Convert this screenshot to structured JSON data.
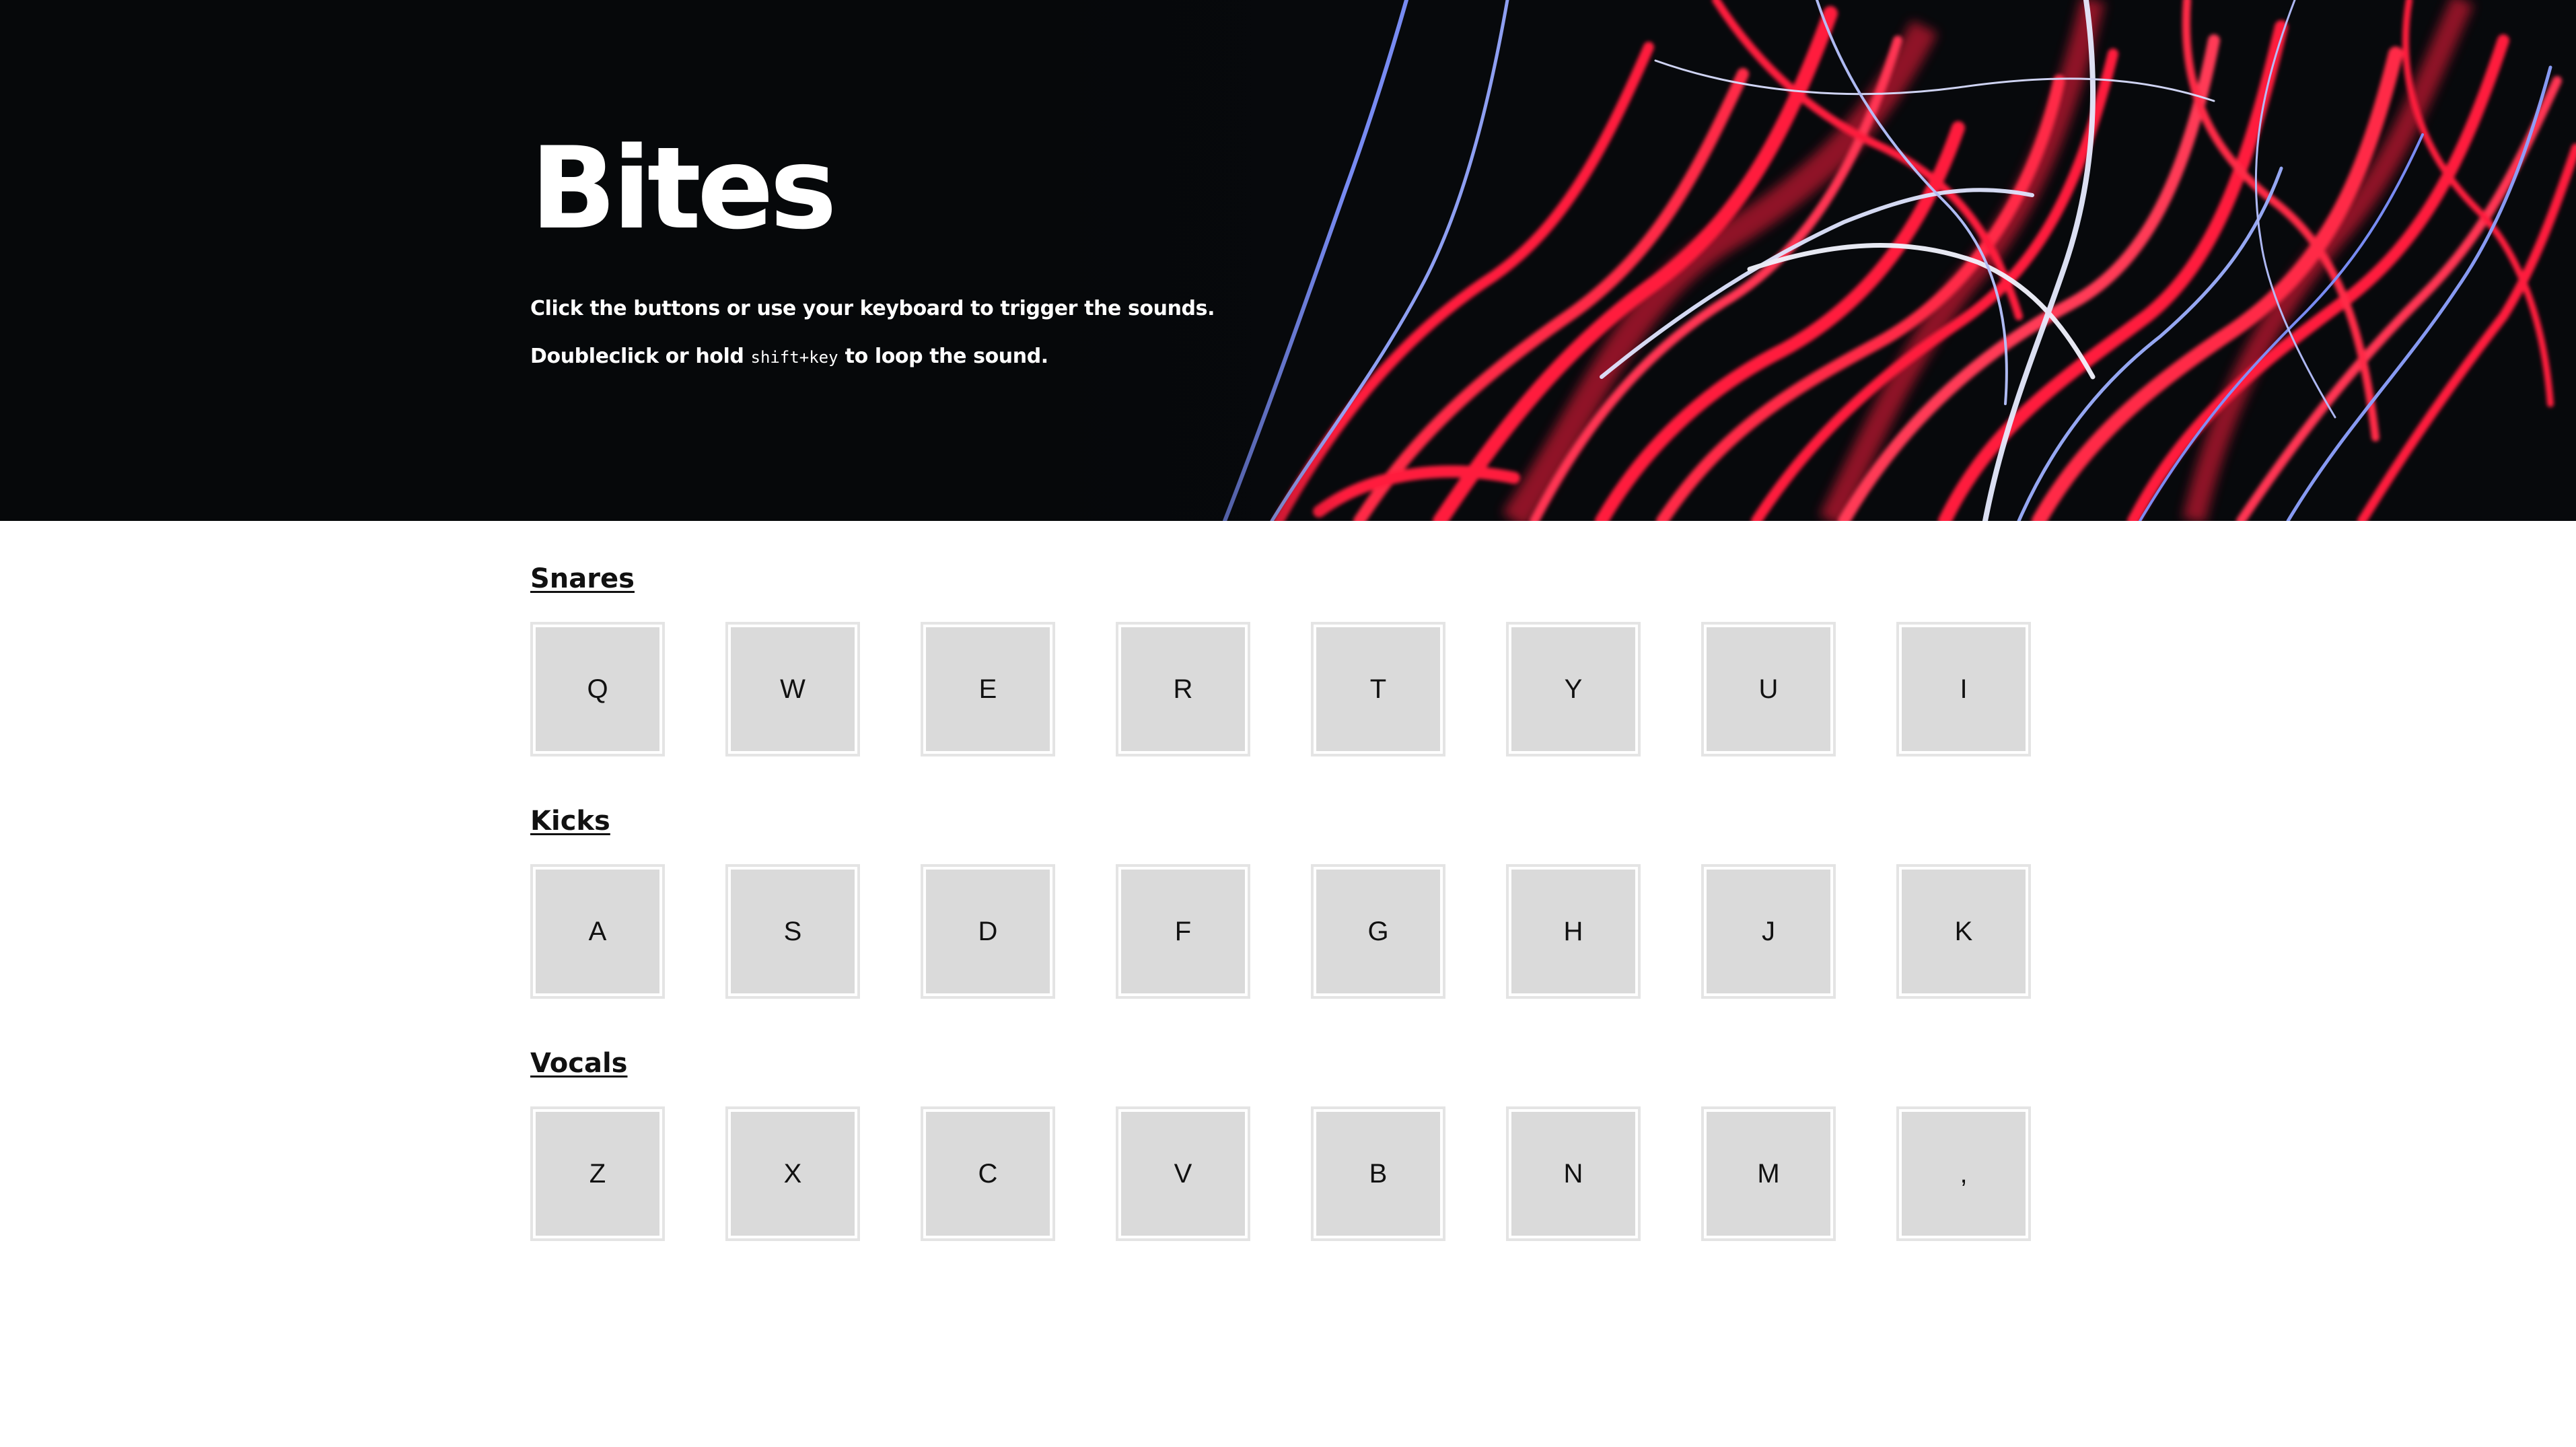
{
  "hero": {
    "title": "Bites",
    "line1": "Click the buttons or use your keyboard to trigger the sounds.",
    "line2_before": "Doubleclick or hold ",
    "line2_code": "shift+key",
    "line2_after": " to loop the sound.",
    "background": "abstract red and blue light trails on black",
    "colors": {
      "base": "#07090c",
      "red": "#ff1f3d",
      "blue": "#8ea2ff",
      "white": "#f2f4ff"
    }
  },
  "sections": [
    {
      "title": "Snares",
      "keys": [
        "Q",
        "W",
        "E",
        "R",
        "T",
        "Y",
        "U",
        "I"
      ]
    },
    {
      "title": "Kicks",
      "keys": [
        "A",
        "S",
        "D",
        "F",
        "G",
        "H",
        "J",
        "K"
      ]
    },
    {
      "title": "Vocals",
      "keys": [
        "Z",
        "X",
        "C",
        "V",
        "B",
        "N",
        "M",
        ","
      ]
    }
  ],
  "theme": {
    "pad_border": "#e4e4e4",
    "pad_fill": "#dadada",
    "text": "#111111"
  }
}
